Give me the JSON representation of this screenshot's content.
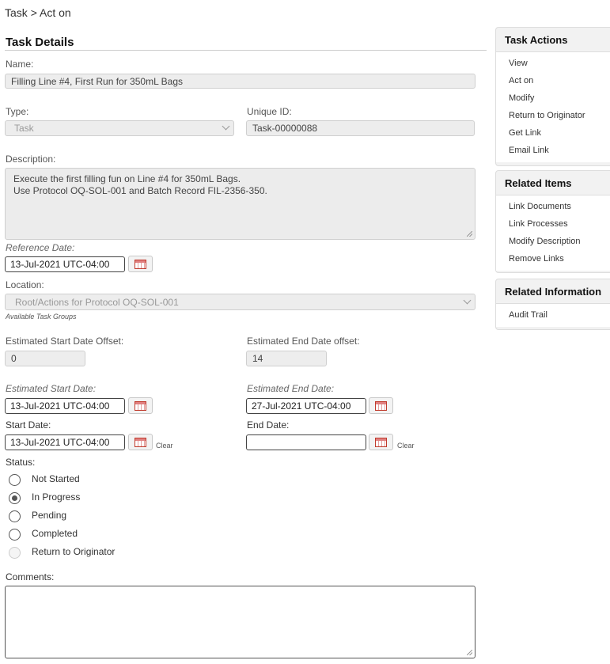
{
  "breadcrumb": {
    "root": "Task",
    "sep": ">",
    "current": "Act on"
  },
  "section_title": "Task Details",
  "name": {
    "label": "Name:",
    "value": "Filling Line #4, First Run for 350mL Bags"
  },
  "type": {
    "label": "Type:",
    "value": "Task"
  },
  "unique_id": {
    "label": "Unique ID:",
    "value": "Task-00000088"
  },
  "description": {
    "label": "Description:",
    "value": "Execute the first filling fun on Line #4 for 350mL Bags.\nUse Protocol OQ-SOL-001 and Batch Record FIL-2356-350."
  },
  "reference_date": {
    "label": "Reference Date:",
    "value": "13-Jul-2021 UTC-04:00"
  },
  "location": {
    "label": "Location:",
    "value": "Root/Actions for Protocol OQ-SOL-001",
    "hint": "Available Task Groups"
  },
  "est_start_offset": {
    "label": "Estimated Start Date Offset:",
    "value": "0"
  },
  "est_end_offset": {
    "label": "Estimated End Date offset:",
    "value": "14"
  },
  "est_start_date": {
    "label": "Estimated Start Date:",
    "value": "13-Jul-2021 UTC-04:00"
  },
  "est_end_date": {
    "label": "Estimated End Date:",
    "value": "27-Jul-2021 UTC-04:00"
  },
  "start_date": {
    "label": "Start Date:",
    "value": "13-Jul-2021 UTC-04:00",
    "clear": "Clear"
  },
  "end_date": {
    "label": "End Date:",
    "value": "",
    "clear": "Clear"
  },
  "status": {
    "label": "Status:",
    "selected": "In Progress",
    "options": [
      "Not Started",
      "In Progress",
      "Pending",
      "Completed",
      "Return to Originator"
    ]
  },
  "comments": {
    "label": "Comments:",
    "value": ""
  },
  "task_actions": {
    "title": "Task Actions",
    "items": [
      "View",
      "Act on",
      "Modify",
      "Return to Originator",
      "Get Link",
      "Email Link"
    ]
  },
  "related_items": {
    "title": "Related Items",
    "items": [
      "Link Documents",
      "Link Processes",
      "Modify Description",
      "Remove Links"
    ]
  },
  "related_information": {
    "title": "Related Information",
    "items": [
      "Audit Trail"
    ]
  },
  "colors": {
    "accent": "#c0392b",
    "field_bg": "#ededed",
    "panel_bg": "#f2f2f2"
  },
  "icons": {
    "calendar": "calendar-icon",
    "dropdown": "chevron-down-icon",
    "resize": "resize-grip-icon"
  }
}
